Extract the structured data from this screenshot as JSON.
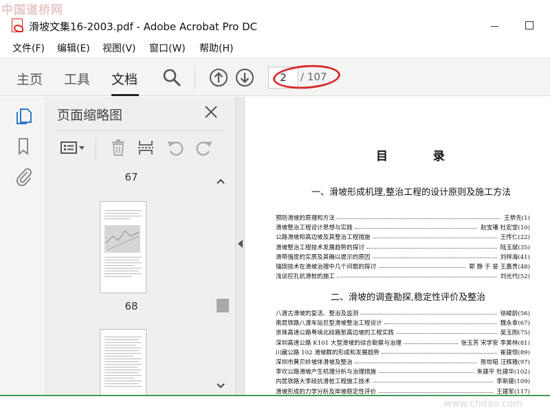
{
  "watermark": {
    "top": "中国道桥网",
    "bottom": "www.chdao.com"
  },
  "window": {
    "title": "滑坡文集16-2003.pdf - Adobe Acrobat Pro DC"
  },
  "menu": [
    "文件(F)",
    "编辑(E)",
    "视图(V)",
    "窗口(W)",
    "帮助(H)"
  ],
  "toolbar": {
    "tabs": [
      "主页",
      "工具",
      "文档"
    ],
    "active_tab": "文档",
    "page_current": "2",
    "page_total": "/ 107",
    "highlight_color": "#d92a2a"
  },
  "panel": {
    "title": "页面缩略图",
    "thumbs": [
      {
        "label": "67"
      },
      {
        "label": "68"
      }
    ]
  },
  "document": {
    "heading": "目  录",
    "sections": [
      {
        "title": "一、滑坡形成机理,整治工程的设计原则及施工方法",
        "entries": [
          {
            "title": "预防滑坡的原理和方法",
            "author": "王恭先(1)"
          },
          {
            "title": "滑坡整治工程设计思想与实践",
            "author": "赵宝璠 杜宏堂(10)"
          },
          {
            "title": "公路滑坡和高边坡及其整治工程措施",
            "author": "王传仁(22)"
          },
          {
            "title": "滑坡整治工程技术发展趋势的探讨",
            "author": "陆玉斌(35)"
          },
          {
            "title": "滑带强度的实质及其确以提示的原因",
            "author": "刘祥海(41)"
          },
          {
            "title": "锚固技术在滑坡治理中几个问题的探讨",
            "author": "郭 静 于 斐 王嘉贵(48)"
          },
          {
            "title": "浅谈挖孔抗滑桩的施工",
            "author": "刘光代(52)"
          }
        ]
      },
      {
        "title": "二、滑坡的调查勘探,稳定性评价及整治",
        "entries": [
          {
            "title": "八渡古滑坡的复活、整治及监测",
            "author": "徐峻龄(56)"
          },
          {
            "title": "南昆铁路八渡车站巨型滑坡整治工程设计",
            "author": "魏永幸(67)"
          },
          {
            "title": "京珠高速公路粤境北段路堑高边坡的工程实践",
            "author": "吴玉刚(75)"
          },
          {
            "title": "深圳高速公路 K101 大型滑坡的综合勘察与治理",
            "author": "张玉芳 宋学安 李昊林(81)"
          },
          {
            "title": "川藏公路 102 滑坡群的形成和发展趋势",
            "author": "崔建恒(89)"
          },
          {
            "title": "深圳市黄贝岭坡体滑坡及整治",
            "author": "陈世昭 汪辉雅(97)"
          },
          {
            "title": "李坎公路滑坡产生机理分析与治理措施",
            "author": "朱建平 杜建华(102)"
          },
          {
            "title": "内昆铁路大李段抗滑桩工程施工技术",
            "author": "李新建(109)"
          },
          {
            "title": "滑坡形成的力学分析及岸坡稳定性评价",
            "author": "王建军(117)"
          }
        ]
      }
    ]
  }
}
